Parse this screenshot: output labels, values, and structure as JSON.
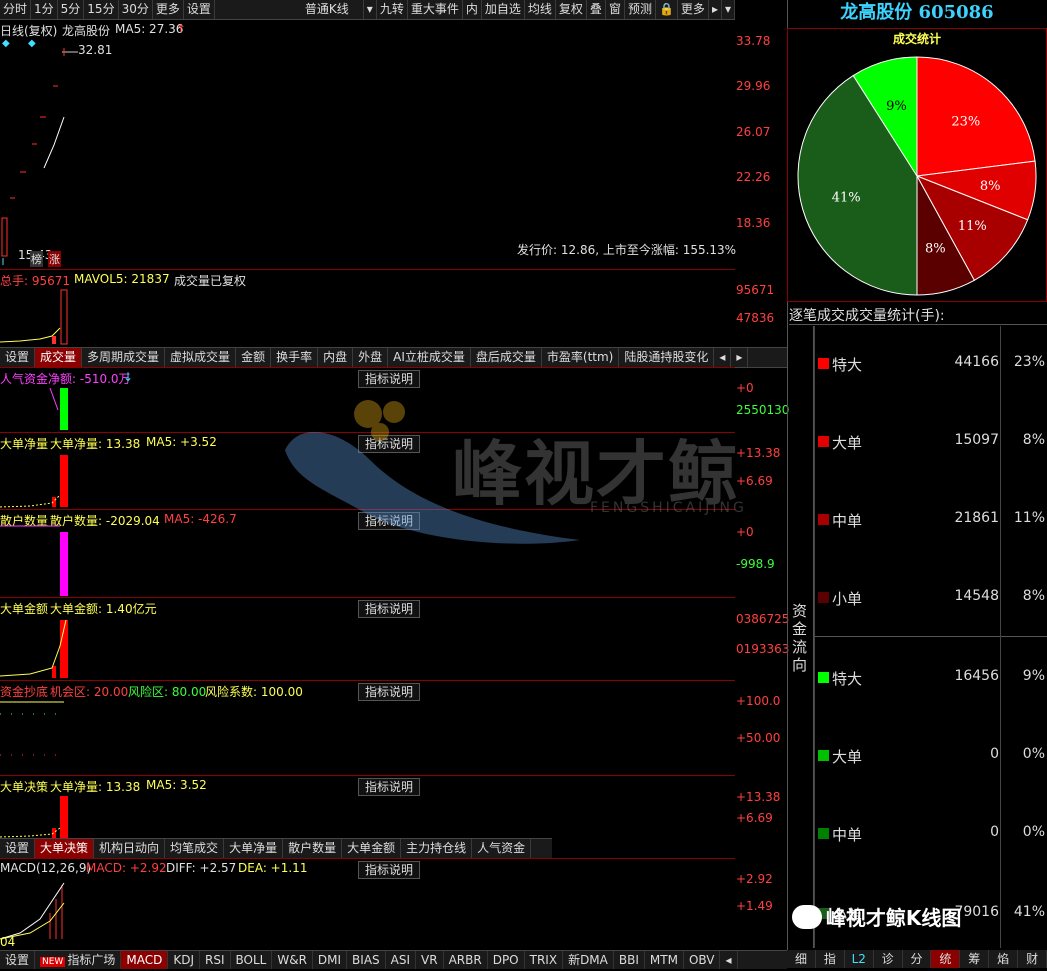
{
  "toolbar": {
    "items": [
      "分时",
      "1分",
      "5分",
      "15分",
      "30分",
      "更多",
      "设置"
    ],
    "kline_type": "普通K线",
    "right_items": [
      "九转",
      "重大事件",
      "内",
      "加自选",
      "均线",
      "复权",
      "叠",
      "窗",
      "预测",
      "更多"
    ]
  },
  "kline": {
    "header_period": "日线(复权)",
    "stock_name": "龙高股份",
    "ma5": "MA5: 27.36",
    "high_label": "32.81",
    "low_label": "15.43",
    "axis": [
      "33.78",
      "29.96",
      "26.07",
      "22.26",
      "18.36"
    ],
    "ipo_info": "发行价: 12.86, 上市至今涨幅: 155.13%",
    "badge_bang": "榜",
    "badge_zhang": "涨"
  },
  "volume": {
    "label_total": "总手: 95671",
    "label_mavol": "MAVOL5: 21837",
    "label_note": "成交量已复权",
    "axis": [
      "95671",
      "47836"
    ]
  },
  "tabs1": [
    "设置",
    "成交量",
    "多周期成交量",
    "虚拟成交量",
    "金额",
    "换手率",
    "内盘",
    "外盘",
    "AI立桩成交量",
    "盘后成交量",
    "市盈率(ttm)",
    "陆股通持股变化"
  ],
  "indicator_panels": {
    "popularity": {
      "label": "人气资金净额: -510.0万",
      "axis": [
        "+0",
        "2550130"
      ]
    },
    "big_net": {
      "label1": "大单净量",
      "label2": "大单净量: 13.38",
      "label3": "MA5: +3.52",
      "axis": [
        "+13.38",
        "+6.69"
      ]
    },
    "retail": {
      "label1": "散户数量",
      "label2": "散户数量: -2029.04",
      "label3": "MA5: -426.7",
      "axis": [
        "+0",
        "-998.9"
      ]
    },
    "big_amount": {
      "label1": "大单金额",
      "label2": "大单金额: 1.40亿元",
      "axis": [
        "0386725",
        "0193363"
      ]
    },
    "bottom_fish": {
      "label1": "资金抄底",
      "label2": "机会区: 20.00",
      "label3": "风险区: 80.00",
      "label4": "风险系数: 100.00",
      "axis": [
        "+100.0",
        "+50.00"
      ]
    },
    "big_decision": {
      "label1": "大单决策",
      "label2": "大单净量: 13.38",
      "label3": "MA5: 3.52",
      "axis": [
        "+13.38",
        "+6.69"
      ]
    },
    "macd": {
      "label1": "MACD(12,26,9)",
      "label2": "MACD: +2.92",
      "label3": "DIFF: +2.57",
      "label4": "DEA: +1.11",
      "axis": [
        "+2.92",
        "+1.49"
      ],
      "corner": "04"
    }
  },
  "explain_label": "指标说明",
  "tabs2": [
    "设置",
    "大单决策",
    "机构日动向",
    "均笔成交",
    "大单净量",
    "散户数量",
    "大单金额",
    "主力持仓线",
    "人气资金"
  ],
  "bottom_tabs": [
    "设置",
    "指标广场",
    "MACD",
    "KDJ",
    "RSI",
    "BOLL",
    "W&R",
    "DMI",
    "BIAS",
    "ASI",
    "VR",
    "ARBR",
    "DPO",
    "TRIX",
    "新DMA",
    "BBI",
    "MTM",
    "OBV"
  ],
  "bottom_new_badge": "NEW",
  "right": {
    "title": "龙高股份 605086",
    "pie_title": "成交统计",
    "pie": [
      {
        "label": "23%",
        "value": 23,
        "color": "#ff0000"
      },
      {
        "label": "8%",
        "value": 8,
        "color": "#e00000"
      },
      {
        "label": "11%",
        "value": 11,
        "color": "#a80000"
      },
      {
        "label": "8%",
        "value": 8,
        "color": "#5a0000"
      },
      {
        "label": "41%",
        "value": 41,
        "color": "#1a5c1a"
      },
      {
        "label": "9%",
        "value": 9,
        "color": "#00ff00"
      }
    ],
    "stats_title": "逐笔成交成交量统计(手):",
    "side_label": "资金流向",
    "rows": [
      {
        "name": "特大",
        "vol": "44166",
        "pct": "23%",
        "color": "#ff0000"
      },
      {
        "name": "大单",
        "vol": "15097",
        "pct": "8%",
        "color": "#e00000"
      },
      {
        "name": "中单",
        "vol": "21861",
        "pct": "11%",
        "color": "#a80000"
      },
      {
        "name": "小单",
        "vol": "14548",
        "pct": "8%",
        "color": "#5a0000"
      },
      {
        "name": "特大",
        "vol": "16456",
        "pct": "9%",
        "color": "#00ff00"
      },
      {
        "name": "大单",
        "vol": "0",
        "pct": "0%",
        "color": "#00c000"
      },
      {
        "name": "中单",
        "vol": "0",
        "pct": "0%",
        "color": "#008000"
      },
      {
        "name": "小单",
        "vol": "79016",
        "pct": "41%",
        "color": "#1a5c1a"
      }
    ],
    "bottom_tabs": [
      "细",
      "指",
      "L2",
      "诊",
      "分",
      "统",
      "筹",
      "焰",
      "财"
    ]
  },
  "watermark": {
    "text": "峰视才鲸",
    "sub": "FENGSHICAIJING",
    "caption": "峰视才鲸K线图"
  }
}
